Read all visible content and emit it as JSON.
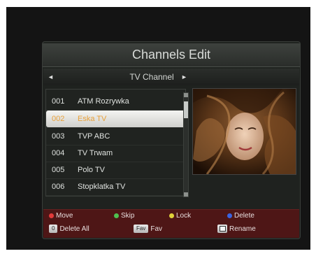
{
  "title": "Channels Edit",
  "subbar": {
    "label": "TV Channel",
    "left_arrow": "◄",
    "right_arrow": "►"
  },
  "channels": [
    {
      "num": "001",
      "name": "ATM Rozrywka"
    },
    {
      "num": "002",
      "name": "Eska TV"
    },
    {
      "num": "003",
      "name": "TVP ABC"
    },
    {
      "num": "004",
      "name": "TV Trwam"
    },
    {
      "num": "005",
      "name": "Polo TV"
    },
    {
      "num": "006",
      "name": "Stopklatka TV"
    }
  ],
  "selected_index": 1,
  "footer": {
    "move": "Move",
    "skip": "Skip",
    "lock": "Lock",
    "delete": "Delete",
    "delete_all_key": "0",
    "delete_all": "Delete All",
    "fav_key": "Fav",
    "fav": "Fav",
    "rename": "Rename"
  },
  "colors": {
    "red": "#e23a3a",
    "green": "#4fc04f",
    "yellow": "#e0d13a",
    "blue": "#3a63e0",
    "selection_text": "#e8a13a"
  }
}
